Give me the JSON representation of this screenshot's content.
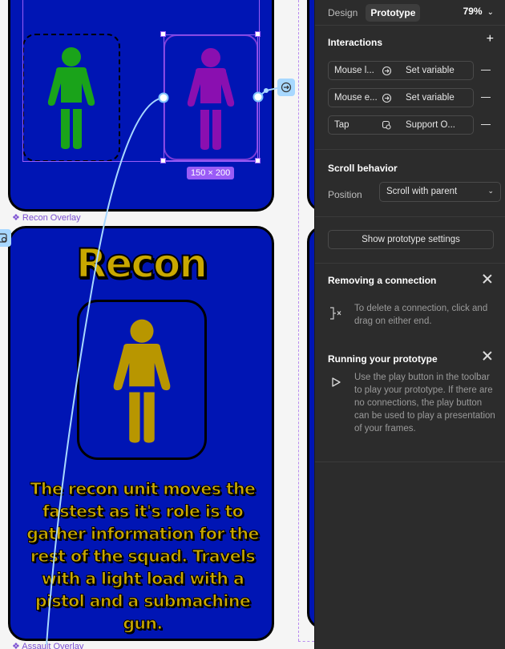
{
  "canvas": {
    "recon_title": "Recon",
    "recon_description": "The recon unit moves the fastest as it's role is to gather information for the rest of the squad. Travels with a light load with a pistol and a submachine gun.",
    "overlay_labels": {
      "recon": "❖ Recon Overlay",
      "assault": "❖ Assault Overlay"
    },
    "selection_size": "150 × 200",
    "colors": {
      "frame_bg": "#0015b4",
      "green_figure": "#1aa31a",
      "purple_figure": "#8a0fb0",
      "gold_figure": "#b89600",
      "text_gold": "#c9a800",
      "selection": "#9a5cf6",
      "connector": "#a8d8ff"
    }
  },
  "panel": {
    "tabs": [
      {
        "label": "Design",
        "active": false
      },
      {
        "label": "Prototype",
        "active": true
      }
    ],
    "zoom": "79%",
    "interactions": {
      "title": "Interactions",
      "add_icon": "plus-icon",
      "rows": [
        {
          "trigger": "Mouse l...",
          "action": "Set variable",
          "icon": "variable-icon"
        },
        {
          "trigger": "Mouse e...",
          "action": "Set variable",
          "icon": "variable-icon"
        },
        {
          "trigger": "Tap",
          "action": "Support O...",
          "icon": "overlay-icon"
        }
      ]
    },
    "scroll": {
      "title": "Scroll behavior",
      "position_label": "Position",
      "position_value": "Scroll with parent"
    },
    "settings_button": "Show prototype settings",
    "tips": [
      {
        "title": "Removing a connection",
        "text": "To delete a connection, click and drag on either end."
      },
      {
        "title": "Running your prototype",
        "text": "Use the play button in the toolbar to play your prototype. If there are no connections, the play button can be used to play a presentation of your frames."
      }
    ]
  }
}
